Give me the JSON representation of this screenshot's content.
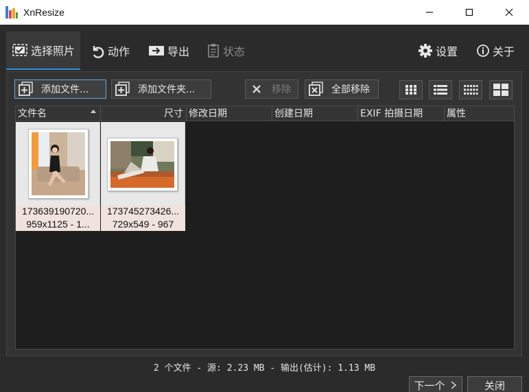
{
  "window": {
    "title": "XnResize"
  },
  "tabs": [
    {
      "label": "选择照片",
      "icon": "select-photos-icon",
      "state": "active"
    },
    {
      "label": "动作",
      "icon": "action-icon",
      "state": "normal"
    },
    {
      "label": "导出",
      "icon": "export-icon",
      "state": "normal"
    },
    {
      "label": "状态",
      "icon": "status-icon",
      "state": "disabled"
    }
  ],
  "top_right": {
    "settings": "设置",
    "about": "关于"
  },
  "toolbar": {
    "add_files": "添加文件...",
    "add_folder": "添加文件夹...",
    "remove": "移除",
    "remove_all": "全部移除"
  },
  "columns": [
    "文件名",
    "尺寸",
    "修改日期",
    "创建日期",
    "EXIF 拍摄日期",
    "属性"
  ],
  "files": [
    {
      "name": "173639190720...",
      "info": "959x1125 - 1..."
    },
    {
      "name": "173745273426...",
      "info": "729x549 - 967"
    }
  ],
  "status": "2 个文件 - 源: 2.23 MB - 输出(估计): 1.13 MB",
  "footer": {
    "next": "下一个",
    "close": "关闭"
  },
  "colors": {
    "accent": "#2f8bd8",
    "background": "#2b2b2b",
    "list_bg": "#1e1e1e"
  }
}
